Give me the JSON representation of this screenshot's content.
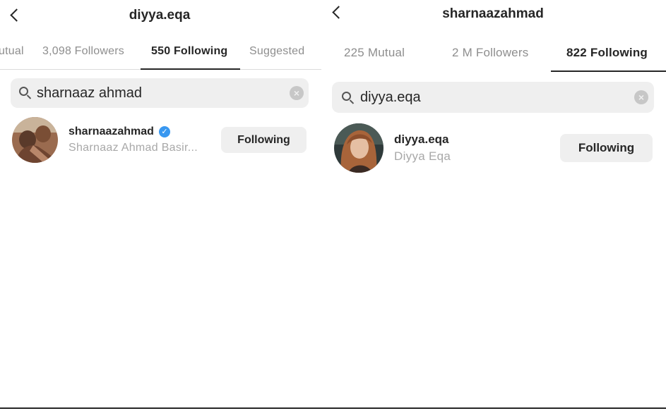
{
  "left": {
    "title": "diyya.eqa",
    "tabs": [
      {
        "label": "utual",
        "active": false
      },
      {
        "label": "3,098 Followers",
        "active": false
      },
      {
        "label": "550 Following",
        "active": true
      },
      {
        "label": "Suggested",
        "active": false
      }
    ],
    "search": {
      "query": "sharnaaz ahmad",
      "placeholder": "Search"
    },
    "result": {
      "username": "sharnaazahmad",
      "full_name": "Sharnaaz Ahmad Basir...",
      "verified": true,
      "button_label": "Following"
    }
  },
  "right": {
    "title": "sharnaazahmad",
    "tabs": [
      {
        "label": "225 Mutual",
        "active": false
      },
      {
        "label": "2 M Followers",
        "active": false
      },
      {
        "label": "822 Following",
        "active": true
      }
    ],
    "search": {
      "query": "diyya.eqa",
      "placeholder": "Search"
    },
    "result": {
      "username": "diyya.eqa",
      "full_name": "Diyya Eqa",
      "verified": false,
      "button_label": "Following"
    }
  },
  "colors": {
    "text_primary": "#262626",
    "text_secondary": "#8e8e8e",
    "search_bg": "#efefef",
    "button_bg": "#efefef",
    "verified_blue": "#3897f0"
  },
  "icons": {
    "back": "chevron-left-icon",
    "search": "search-icon",
    "clear": "clear-icon",
    "verified": "verified-badge-icon"
  }
}
